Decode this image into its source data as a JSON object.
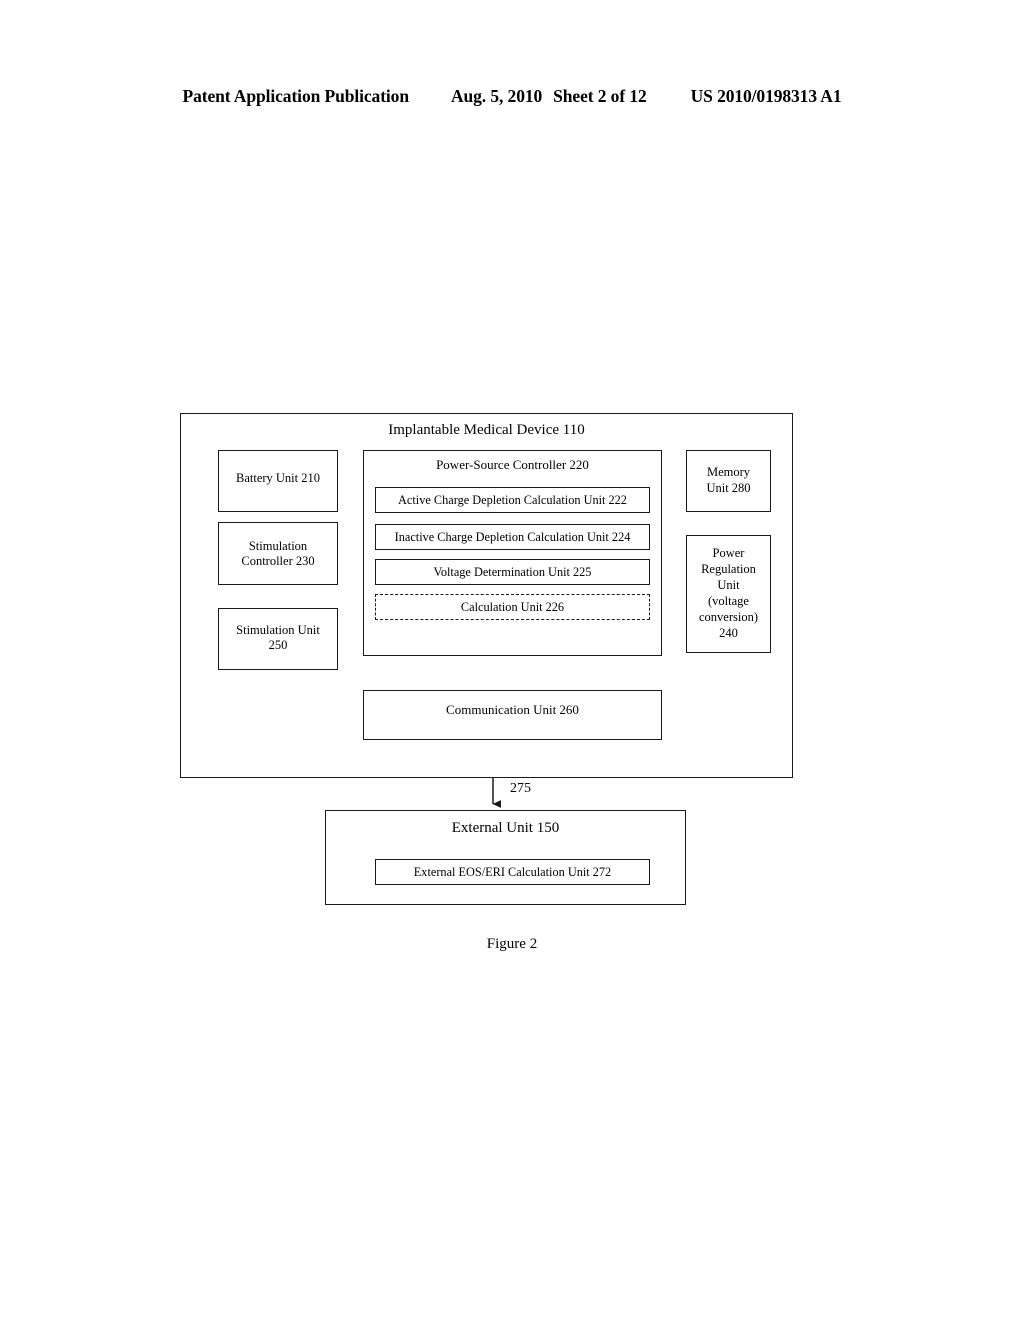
{
  "header": {
    "publication": "Patent Application Publication",
    "date": "Aug. 5, 2010",
    "sheet": "Sheet 2 of 12",
    "number": "US 2010/0198313 A1"
  },
  "figure": {
    "caption": "Figure 2",
    "connector_label": "275"
  },
  "imd": {
    "title": "Implantable Medical Device 110",
    "left_column": [
      {
        "label": "Battery Unit 210"
      },
      {
        "label_line1": "Stimulation",
        "label_line2": "Controller 230"
      },
      {
        "label_line1": "Stimulation Unit",
        "label_line2": "250"
      }
    ],
    "power_source_controller": {
      "title": "Power-Source Controller 220",
      "sub_units": [
        {
          "label": "Active Charge Depletion Calculation Unit 222",
          "border": "solid"
        },
        {
          "label": "Inactive Charge Depletion Calculation Unit 224",
          "border": "solid"
        },
        {
          "label": "Voltage Determination Unit 225",
          "border": "solid"
        },
        {
          "label": "Calculation Unit 226",
          "border": "dashed"
        }
      ]
    },
    "right_column": {
      "memory": {
        "line1": "Memory",
        "line2": "Unit 280"
      },
      "power_regulation": {
        "line1": "Power",
        "line2": "Regulation",
        "line3": "Unit",
        "line4": "(voltage",
        "line5": "conversion)",
        "line6": "240"
      }
    },
    "communication_unit": {
      "label": "Communication Unit 260"
    }
  },
  "external": {
    "title": "External Unit 150",
    "sub_unit": {
      "label": "External EOS/ERI Calculation Unit 272"
    }
  },
  "colors": {
    "ink": "#1a1a1a",
    "background": "#ffffff"
  }
}
